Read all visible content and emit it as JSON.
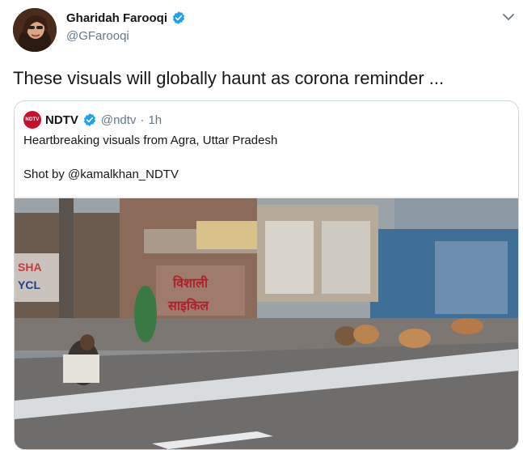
{
  "tweet": {
    "author_name": "Gharidah Farooqi",
    "author_handle": "@GFarooqi",
    "text": "These visuals will globally haunt as corona reminder ...",
    "icons": {
      "verified": "verified-badge-icon",
      "menu": "chevron-down-icon",
      "avatar": "profile-photo"
    }
  },
  "quoted": {
    "logo_text": "NDTV",
    "author_name": "NDTV",
    "author_handle": "@ndtv",
    "separator": "·",
    "time": "1h",
    "line1": "Heartbreaking visuals from Agra, Uttar Pradesh",
    "line2": "Shot by @kamalkhan_NDTV",
    "media": {
      "description": "video-still-street-scene",
      "signs": [
        "विशाली",
        "साइकिल"
      ]
    }
  },
  "colors": {
    "verified": "#1da1f2",
    "ndtv_red": "#c8102e",
    "muted": "#657786",
    "border": "#ccd6dd"
  }
}
